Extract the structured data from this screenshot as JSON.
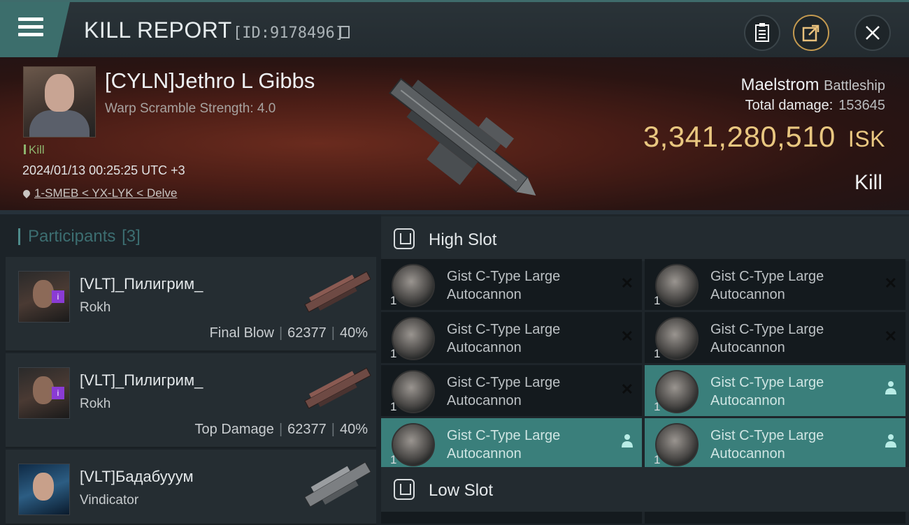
{
  "header": {
    "title": "KILL REPORT",
    "kill_id": "[ID:9178496]"
  },
  "victim": {
    "name": "[CYLN]Jethro L Gibbs",
    "warp_scramble": "Warp Scramble Strength: 4.0",
    "tag": "Kill",
    "datetime": "2024/01/13 00:25:25 UTC +3",
    "location": "1-SMEB < YX-LYK < Delve",
    "ship": "Maelstrom",
    "ship_class": "Battleship",
    "total_damage_label": "Total damage:",
    "total_damage": "153645",
    "isk_value": "3,341,280,510",
    "isk_currency": "ISK",
    "result": "Kill"
  },
  "participants": {
    "label": "Participants",
    "count": "[3]",
    "items": [
      {
        "name": "[VLT]_Пилигрим_",
        "ship": "Rokh",
        "role": "Final Blow",
        "damage": "62377",
        "percent": "40%"
      },
      {
        "name": "[VLT]_Пилигрим_",
        "ship": "Rokh",
        "role": "Top Damage",
        "damage": "62377",
        "percent": "40%"
      },
      {
        "name": "[VLT]Бадабууум",
        "ship": "Vindicator",
        "role": "",
        "damage": "",
        "percent": ""
      }
    ]
  },
  "fittings": {
    "high_slot_label": "High Slot",
    "low_slot_label": "Low Slot",
    "high_slots": [
      {
        "name_line1": "Gist C-Type Large",
        "name_line2": "Autocannon",
        "qty": "1",
        "state": "destroyed"
      },
      {
        "name_line1": "Gist C-Type Large",
        "name_line2": "Autocannon",
        "qty": "1",
        "state": "destroyed"
      },
      {
        "name_line1": "Gist C-Type Large",
        "name_line2": "Autocannon",
        "qty": "1",
        "state": "destroyed"
      },
      {
        "name_line1": "Gist C-Type Large",
        "name_line2": "Autocannon",
        "qty": "1",
        "state": "destroyed"
      },
      {
        "name_line1": "Gist C-Type Large",
        "name_line2": "Autocannon",
        "qty": "1",
        "state": "destroyed"
      },
      {
        "name_line1": "Gist C-Type Large",
        "name_line2": "Autocannon",
        "qty": "1",
        "state": "dropped"
      },
      {
        "name_line1": "Gist C-Type Large",
        "name_line2": "Autocannon",
        "qty": "1",
        "state": "dropped"
      },
      {
        "name_line1": "Gist C-Type Large",
        "name_line2": "Autocannon",
        "qty": "1",
        "state": "dropped"
      }
    ]
  },
  "colors": {
    "accent_teal": "#3a7f7b",
    "isk_gold": "#e9c780",
    "kill_green": "#8db46e"
  },
  "icons": {
    "menu": "hamburger-icon",
    "copy": "copy-icon",
    "clipboard": "clipboard-icon",
    "share": "share-icon",
    "close": "close-icon",
    "location": "location-pin-icon",
    "slot": "slot-icon",
    "destroyed": "x-icon",
    "dropped": "person-icon"
  }
}
